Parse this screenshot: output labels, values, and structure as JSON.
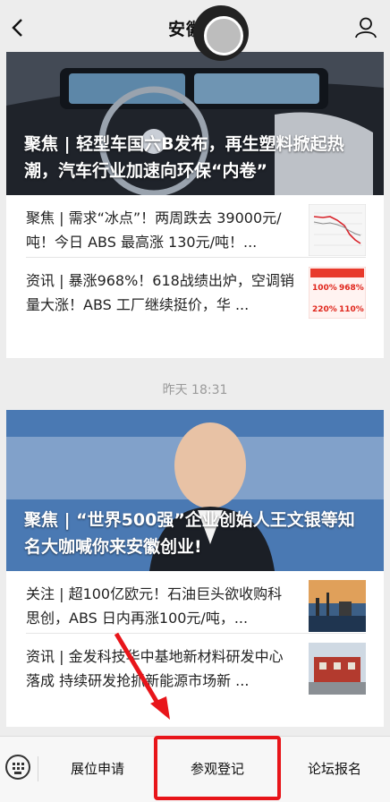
{
  "header": {
    "title": "安徽塑",
    "back_icon": "chevron-left-icon",
    "user_icon": "user-icon"
  },
  "cards": [
    {
      "hero_caption": "聚焦 | 轻型车国六B发布，再生塑料掀起热潮，汽车行业加速向环保“内卷”",
      "rows": [
        {
          "text": "聚焦 | 需求“冰点”！两周跌去 39000元/吨！今日 ABS 最高涨 130元/吨！...",
          "thumb_icon": "line-chart-thumbnail"
        },
        {
          "text": "资讯 | 暴涨968%！618战绩出炉，空调销量大涨！ABS 工厂继续挺价，华 ...",
          "thumb_icon": "percentage-stats-thumbnail",
          "thumb_values": [
            "100%",
            "968%",
            "220%",
            "110%"
          ]
        }
      ]
    },
    {
      "hero_caption": "聚焦 | “世界500强”企业创始人王文银等知名大咖喊你来安徽创业!",
      "rows": [
        {
          "text": "关注 | 超100亿欧元！石油巨头欲收购科思创，ABS 日内再涨100元/吨，...",
          "thumb_icon": "refinery-thumbnail"
        },
        {
          "text": "资讯 | 金发科技华中基地新材料研发中心落成 持续研发抢抓新能源市场新 ...",
          "thumb_icon": "building-thumbnail"
        }
      ]
    }
  ],
  "timestamp": "昨天 18:31",
  "bottom_menu": {
    "keyboard_icon": "keyboard-icon",
    "items": [
      "展位申请",
      "参观登记",
      "论坛报名"
    ]
  },
  "colors": {
    "highlight": "#e8151a",
    "background": "#ededed"
  }
}
